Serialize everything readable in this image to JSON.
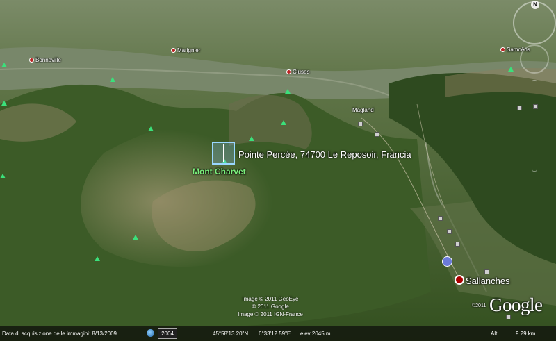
{
  "map": {
    "terrain_colors": {
      "valley": "#6a7a52",
      "forest": "#2f4d23",
      "ridge": "#8a8160",
      "snow_rock": "#b9ad90"
    }
  },
  "places": {
    "bonneville": "Bonneville",
    "marignier": "Marignier",
    "cluses": "Cluses",
    "samoens": "Samoëns",
    "magland": "Magland",
    "sallanches": "Sallanches"
  },
  "placemark": {
    "title": "Pointe Percée, 74700 Le Reposoir, Francia",
    "peak_name": "Mont Charvet"
  },
  "attribution": {
    "line1": "Image © 2011 GeoEye",
    "line2": "© 2011 Google",
    "line3": "Image © 2011 IGN-France",
    "year_small": "©2011"
  },
  "logo": "Google",
  "compass": {
    "north": "N"
  },
  "statusbar": {
    "acquisition": "Data di acquisizione delle immagini: 8/13/2009",
    "year": "2004",
    "lat": "45°58'13.20\"N",
    "lon": "6°33'12.59\"E",
    "elevation": "elev 2045 m",
    "alt_label": "Alt",
    "alt_value": "9.29 km"
  }
}
